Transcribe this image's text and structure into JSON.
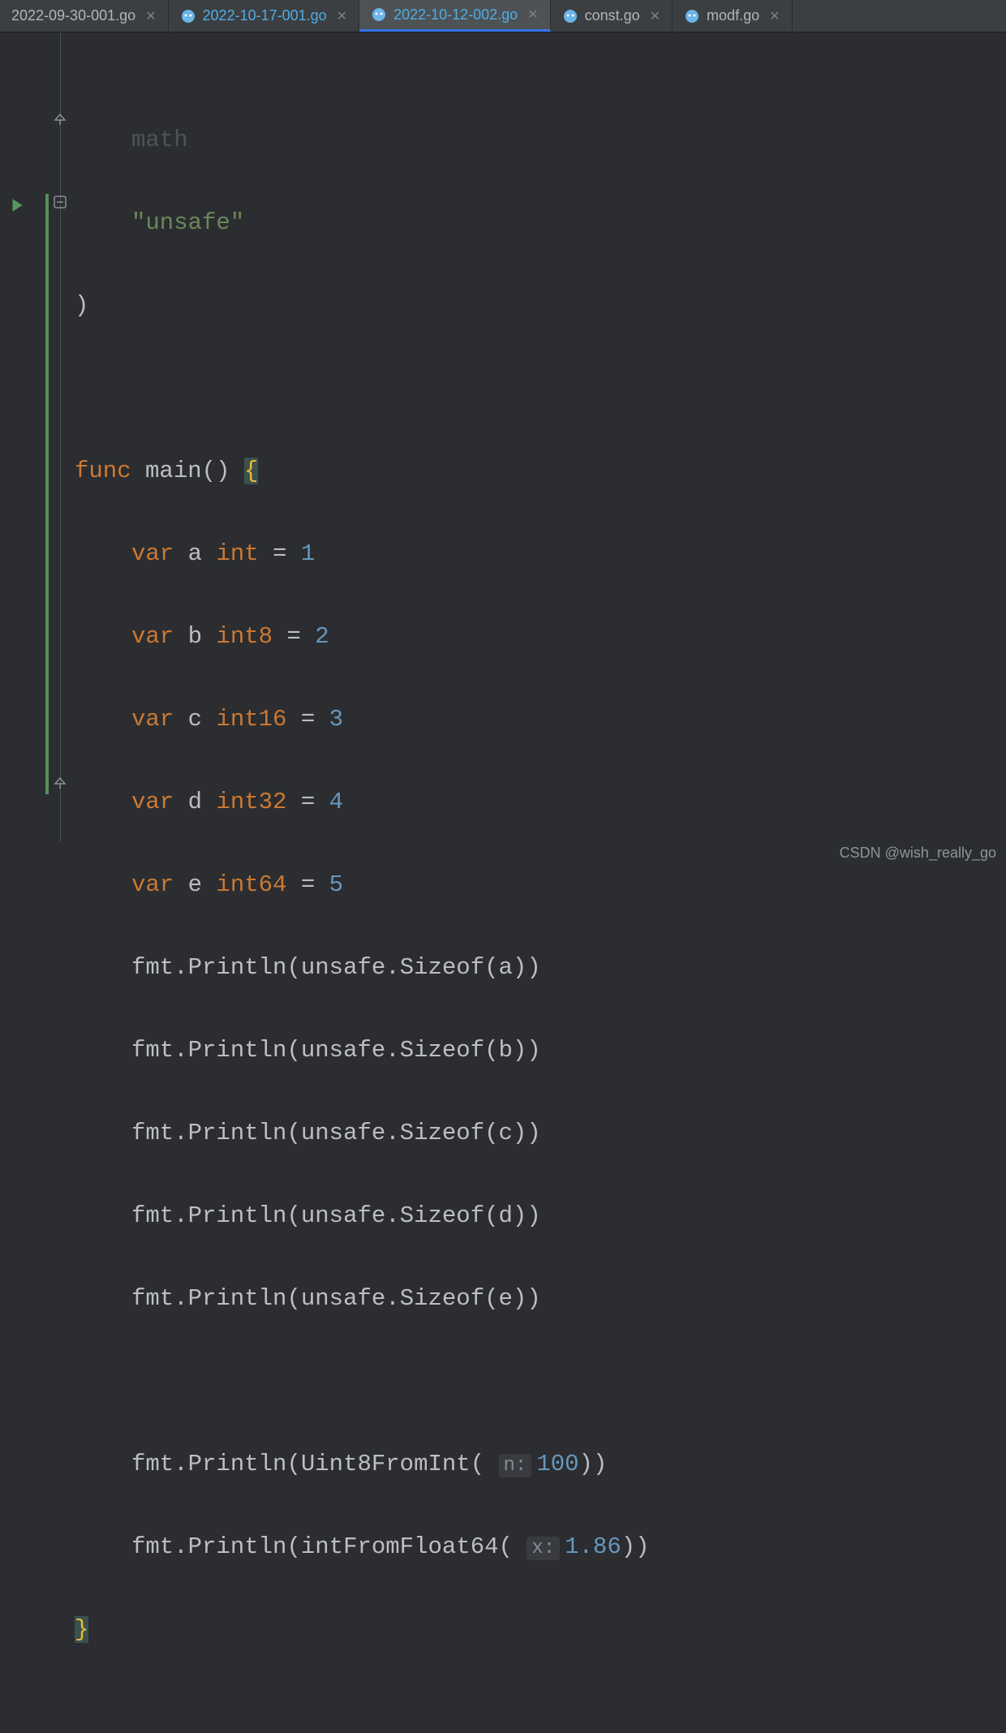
{
  "tabs": [
    {
      "label": "2022-09-30-001.go",
      "active": false,
      "modified": false,
      "has_icon": false
    },
    {
      "label": "2022-10-17-001.go",
      "active": false,
      "modified": true,
      "has_icon": true
    },
    {
      "label": "2022-10-12-002.go",
      "active": true,
      "modified": true,
      "has_icon": true
    },
    {
      "label": "const.go",
      "active": false,
      "modified": false,
      "has_icon": true
    },
    {
      "label": "modf.go",
      "active": false,
      "modified": false,
      "has_icon": true
    }
  ],
  "code": {
    "l0": "math",
    "l1": "\"unsafe\"",
    "l2": ")",
    "kw_func": "func",
    "main": "main",
    "kw_var": "var",
    "a": "a",
    "b": "b",
    "c": "c",
    "d": "d",
    "e": "e",
    "t_int": "int",
    "t_int8": "int8",
    "t_int16": "int16",
    "t_int32": "int32",
    "t_int64": "int64",
    "eq": "=",
    "n1": "1",
    "n2": "2",
    "n3": "3",
    "n4": "4",
    "n5": "5",
    "pkg_fmt": "fmt",
    "fn_println": "Println",
    "pkg_unsafe": "unsafe",
    "fn_sizeof": "Sizeof",
    "fn_uint8": "Uint8FromInt",
    "fn_intfrom": "intFromFloat64",
    "hint_n": "n:",
    "hint_x": "x:",
    "v100": "100",
    "v186": "1.86",
    "brace_open": "{",
    "brace_close": "}",
    "paren_open": "(",
    "paren_close": ")",
    "dot": "."
  },
  "watermark": "CSDN @wish_really_go"
}
